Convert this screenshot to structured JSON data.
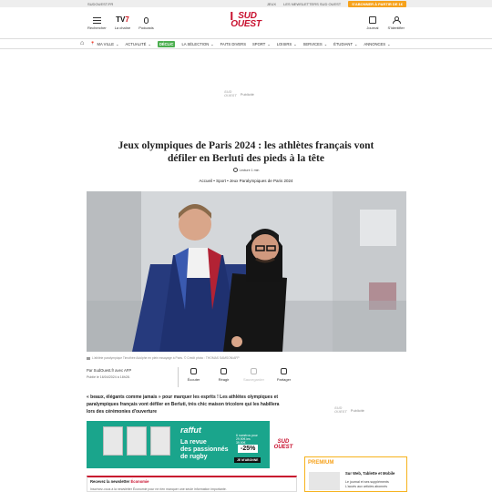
{
  "topbar": {
    "left": "SUDOUEST.FR",
    "links": [
      "JEUX",
      "LES NEWSLETTERS SUD OUEST"
    ],
    "promo": "S'ABONNER À PARTIR DE 1€"
  },
  "header": {
    "search_label": "Rechercher",
    "tv7_label": "La chaîne",
    "podcasts_label": "Podcasts",
    "logo_line1": "SUD",
    "logo_line2": "OUEST",
    "journal_label": "Journal",
    "identify_label": "S'identifier"
  },
  "nav": {
    "items": [
      "MA VILLE",
      "ACTUALITÉ",
      "DÉCLIC",
      "LA SÉLECTION",
      "FAITS DIVERS",
      "SPORT",
      "LOISIRS",
      "SERVICES",
      "ÉTUDIANT",
      "ANNONCES"
    ]
  },
  "ad_top": {
    "logo1": "SUD",
    "logo2": "OUEST",
    "label": "Publicité"
  },
  "article": {
    "title": "Jeux olympiques de Paris 2024 : les athlètes français vont défiler en Berluti des pieds à la tête",
    "reading": "Lecture 1 min",
    "breadcrumb": "Accueil • Sport • Jeux Paralympiques de Paris 2024",
    "caption": "L'athlète paralympique Timothée Adolphe en plein essayage à Paris. © Crédit photo : THOMAS SAMSON/AFP",
    "author": "Par SudOuest.fr avec AFP",
    "date": "Publié le 16/04/2024 à 18h28.",
    "actions": [
      "Écouter",
      "Réagir",
      "Sauvegarder",
      "Partager"
    ],
    "chapo": "« beaux, élégants comme jamais » pour marquer les esprits ! Les athlètes olympiques et paralympiques français vont défiler en Berluti, très chic maison tricolore qui les habillera lors des cérémonies d'ouverture"
  },
  "ad_side": {
    "logo1": "SUD",
    "logo2": "OUEST",
    "label": "Publicité"
  },
  "banner": {
    "brand": "raffut",
    "tagline1": "La revue",
    "tagline2": "des passionnés",
    "tagline3": "de rugby",
    "offer1": "6 numéros pour",
    "offer2": "29,90€ les",
    "offer3": "39,90€",
    "discount": "-25%",
    "cta": "JE M'ABONNE",
    "logo1": "SUD",
    "logo2": "OUEST"
  },
  "newsletter": {
    "title": "Recevez la newsletter ",
    "topic": "Économie",
    "desc": "Inscrivez-vous à la newsletter Économie pour ne rien manquer une seule information importante."
  },
  "premium": {
    "label": "PREMIUM",
    "title": "Sur Web, Tablette et Mobile",
    "desc1": "Le journal et ses suppléments",
    "desc2": "L'accès aux articles abonnés"
  },
  "colors": {
    "brand": "#c8102e",
    "accent": "#f6a21c",
    "declic": "#4caf50",
    "banner": "#1aa58c"
  }
}
